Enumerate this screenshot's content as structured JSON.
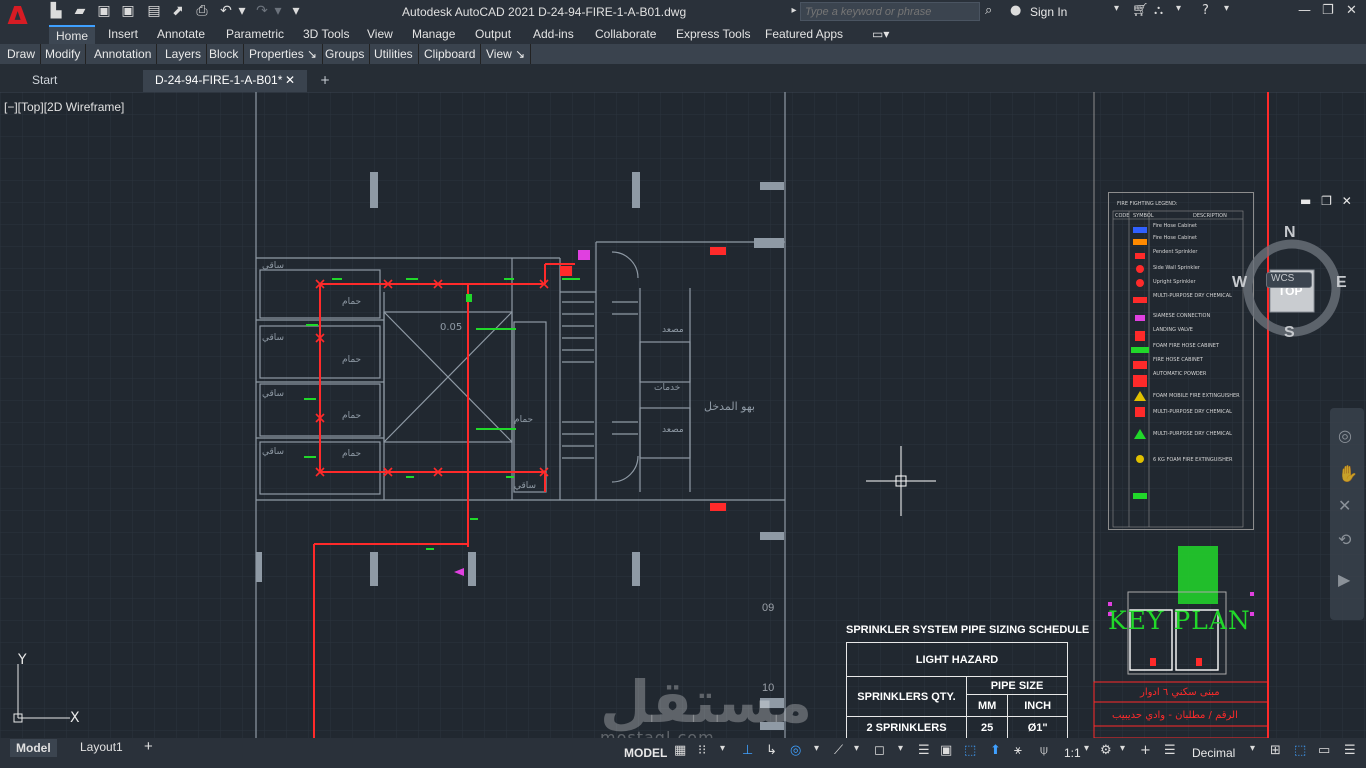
{
  "app": {
    "logo_letter": "A",
    "window_title": "Autodesk AutoCAD 2021    D-24-94-FIRE-1-A-B01.dwg",
    "search_placeholder": "Type a keyword or phrase",
    "sign_in": "Sign In"
  },
  "ribbon_tabs": [
    "Home",
    "Insert",
    "Annotate",
    "Parametric",
    "3D Tools",
    "View",
    "Manage",
    "Output",
    "Add-ins",
    "Collaborate",
    "Express Tools",
    "Featured Apps"
  ],
  "panels": [
    "Draw",
    "Modify",
    "Annotation",
    "Layers",
    "Block",
    "Properties ↘",
    "Groups",
    "Utilities",
    "Clipboard",
    "View ↘"
  ],
  "doc_tabs": {
    "start": "Start",
    "active": "D-24-94-FIRE-1-A-B01*"
  },
  "viewport_controls": "[−][Top][2D Wireframe]",
  "viewcube": {
    "n": "N",
    "s": "S",
    "e": "E",
    "w": "W",
    "face": "TOP",
    "wcs": "WCS"
  },
  "ucs": {
    "x": "X",
    "y": "Y"
  },
  "numbers": {
    "n09": "09",
    "n10": "10",
    "n005": "0.05"
  },
  "plan_labels": {
    "entrance": "بهو المدخل",
    "services": "خدمات",
    "toilet": "ساقي"
  },
  "key_plan": {
    "title": "KEY PLAN",
    "line1": "مبنى سكني ٦ ادوار",
    "line2": "الرقم / مطلبان - وادي حديبيب"
  },
  "legend": {
    "header": "FIRE FIGHTING LEGEND:",
    "cols": [
      "CODE",
      "SYMBOL",
      "DESCRIPTION"
    ],
    "rows": [
      "Fire Hose Cabinet",
      "Fire Hose Cabinet",
      "Pendent Sprinkler",
      "Side Wall Sprinkler",
      "Upright Sprinkler",
      "MULTI-PURPOSE DRY CHEMICAL",
      "SIAMESE CONNECTION",
      "LANDING VALVE",
      "FOAM FIRE HOSE CABINET",
      "FIRE HOSE CABINET",
      "AUTOMATIC POWDER",
      "FOAM MOBILE FIRE EXTINGUISHER",
      "MULTI-PURPOSE DRY CHEMICAL",
      "MULTI-PURPOSE DRY CHEMICAL",
      "6 KG FOAM FIRE EXTINGUISHER"
    ]
  },
  "schedule": {
    "title": "SPRINKLER SYSTEM PIPE SIZING SCHEDULE",
    "hazard": "LIGHT HAZARD",
    "col_qty": "SPRINKLERS QTY.",
    "col_pipe": "PIPE SIZE",
    "col_mm": "MM",
    "col_inch": "INCH",
    "row1_qty": "2 SPRINKLERS",
    "row1_mm": "25",
    "row1_inch": "Ø1\""
  },
  "watermark": {
    "main": "مستقل",
    "sub": "mostaql.com"
  },
  "status": {
    "model_tab": "Model",
    "layout_tab": "Layout1",
    "model": "MODEL",
    "scale": "1:1",
    "units": "Decimal"
  },
  "colors": {
    "accent": "#3fa0ff",
    "pipe": "#ff2a2a",
    "green": "#21d82a",
    "bg": "#212830"
  }
}
